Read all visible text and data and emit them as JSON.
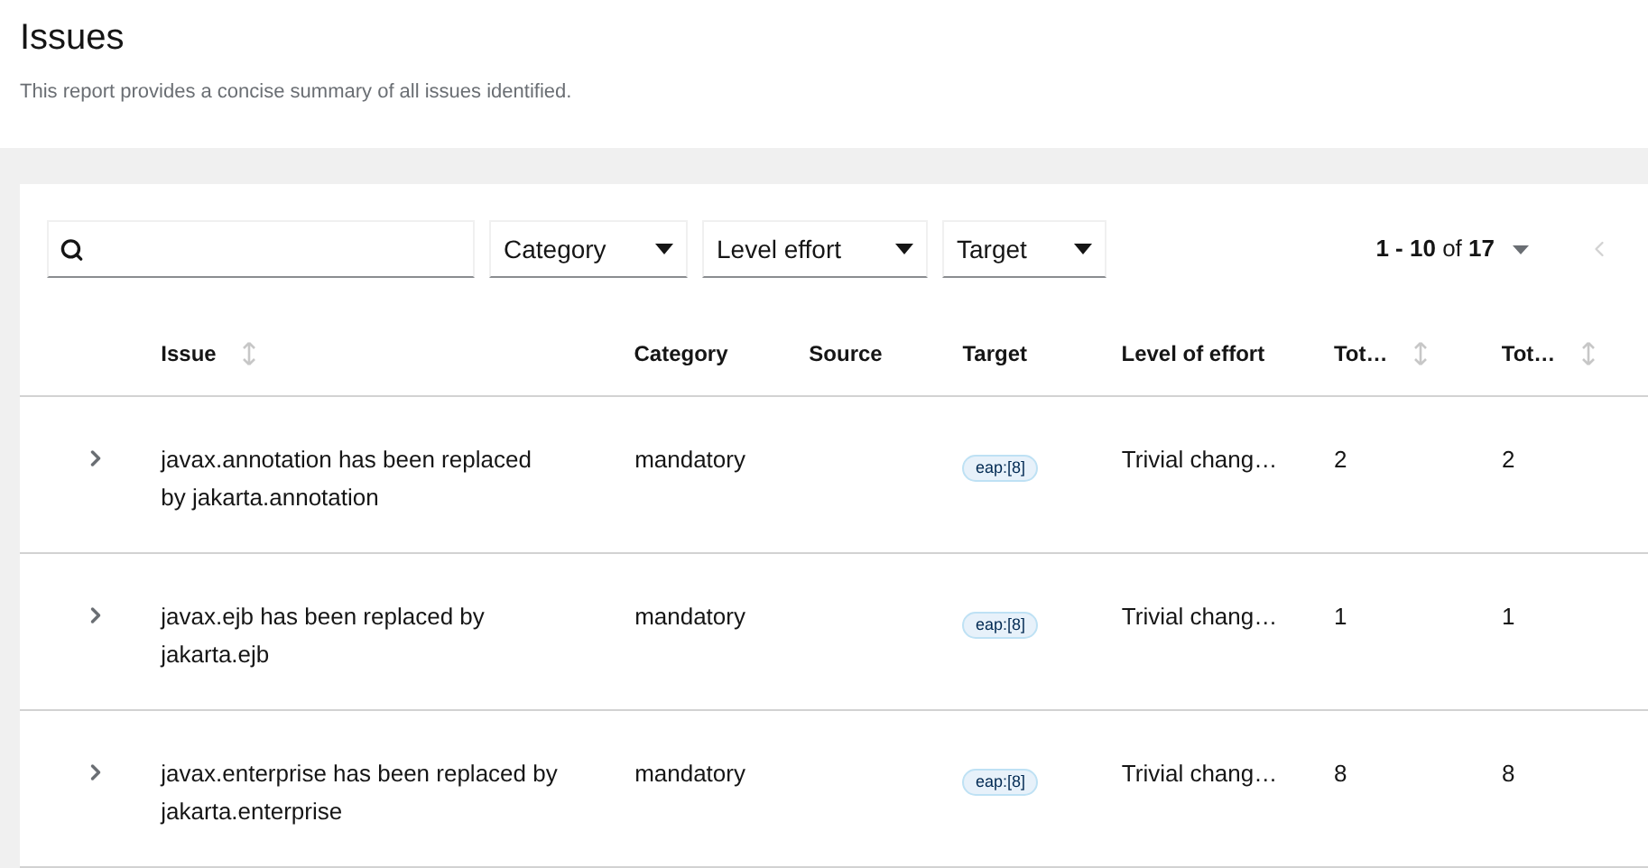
{
  "page": {
    "title": "Issues",
    "description": "This report provides a concise summary of all issues identified."
  },
  "toolbar": {
    "filters": [
      {
        "label": "Category"
      },
      {
        "label": "Level effort"
      },
      {
        "label": "Target"
      }
    ],
    "pagination": {
      "range": "**1 - 10** of **17**"
    }
  },
  "table": {
    "columns": [
      {
        "label": "Issue",
        "sortable": true
      },
      {
        "label": "Category",
        "sortable": false
      },
      {
        "label": "Source",
        "sortable": false
      },
      {
        "label": "Target",
        "sortable": false
      },
      {
        "label": "Level of effort",
        "sortable": false
      },
      {
        "label": "Tot…",
        "sortable": true
      },
      {
        "label": "Tot…",
        "sortable": true
      }
    ],
    "rows": [
      {
        "expanded": false,
        "issue": "javax.annotation has been replaced by jakarta.annotation",
        "category": "mandatory",
        "target": "eap:[8]",
        "effort": "Trivial chang…",
        "total_1": "2",
        "total_2": "2"
      },
      {
        "expanded": false,
        "issue": "javax.ejb has been replaced by jakarta.ejb",
        "category": "mandatory",
        "target": "eap:[8]",
        "effort": "Trivial chang…",
        "total_1": "1",
        "total_2": "1"
      },
      {
        "expanded": false,
        "issue": "javax.enterprise has been replaced by jakarta.enterprise",
        "category": "mandatory",
        "target": "eap:[8]",
        "effort": "Trivial chang…",
        "total_1": "8",
        "total_2": "8"
      }
    ]
  }
}
